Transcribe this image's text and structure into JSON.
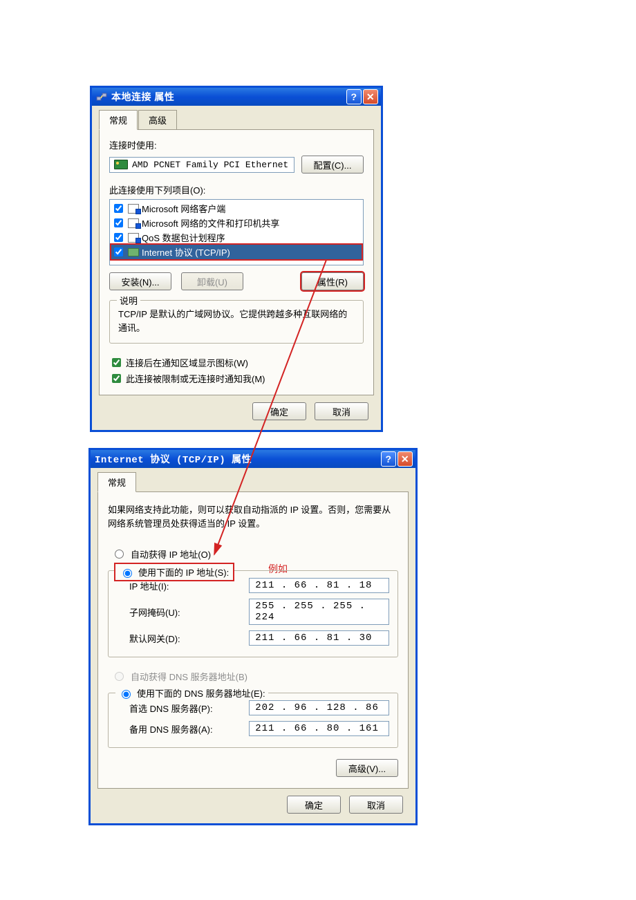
{
  "dialog1": {
    "title": "本地连接 属性",
    "tabs": {
      "general": "常规",
      "advanced": "高级"
    },
    "connect_using_label": "连接时使用:",
    "adapter_name": "AMD PCNET Family PCI Ethernet",
    "configure_btn": "配置(C)...",
    "items_label": "此连接使用下列项目(O):",
    "items": [
      {
        "label": "Microsoft 网络客户端"
      },
      {
        "label": "Microsoft 网络的文件和打印机共享"
      },
      {
        "label": "QoS 数据包计划程序"
      },
      {
        "label": "Internet 协议 (TCP/IP)"
      }
    ],
    "install_btn": "安装(N)...",
    "uninstall_btn": "卸载(U)",
    "properties_btn": "属性(R)",
    "desc_legend": "说明",
    "desc_text": "TCP/IP 是默认的广域网协议。它提供跨越多种互联网络的通讯。",
    "show_icon_label": "连接后在通知区域显示图标(W)",
    "notify_label": "此连接被限制或无连接时通知我(M)",
    "ok_btn": "确定",
    "cancel_btn": "取消"
  },
  "dialog2": {
    "title": "Internet 协议 (TCP/IP) 属性",
    "tab_general": "常规",
    "intro_text": "如果网络支持此功能，则可以获取自动指派的 IP 设置。否则，您需要从网络系统管理员处获得适当的 IP 设置。",
    "auto_ip_label": "自动获得 IP 地址(O)",
    "manual_ip_label": "使用下面的 IP 地址(S):",
    "example_label": "例如",
    "ip_label": "IP 地址(I):",
    "ip_value": "211 . 66  . 81  . 18",
    "mask_label": "子网掩码(U):",
    "mask_value": "255 . 255 . 255 . 224",
    "gw_label": "默认网关(D):",
    "gw_value": "211 . 66  . 81  . 30",
    "auto_dns_label": "自动获得 DNS 服务器地址(B)",
    "manual_dns_label": "使用下面的 DNS 服务器地址(E):",
    "dns1_label": "首选 DNS 服务器(P):",
    "dns1_value": "202 . 96  . 128 . 86",
    "dns2_label": "备用 DNS 服务器(A):",
    "dns2_value": "211 . 66  . 80  . 161",
    "advanced_btn": "高级(V)...",
    "ok_btn": "确定",
    "cancel_btn": "取消"
  }
}
